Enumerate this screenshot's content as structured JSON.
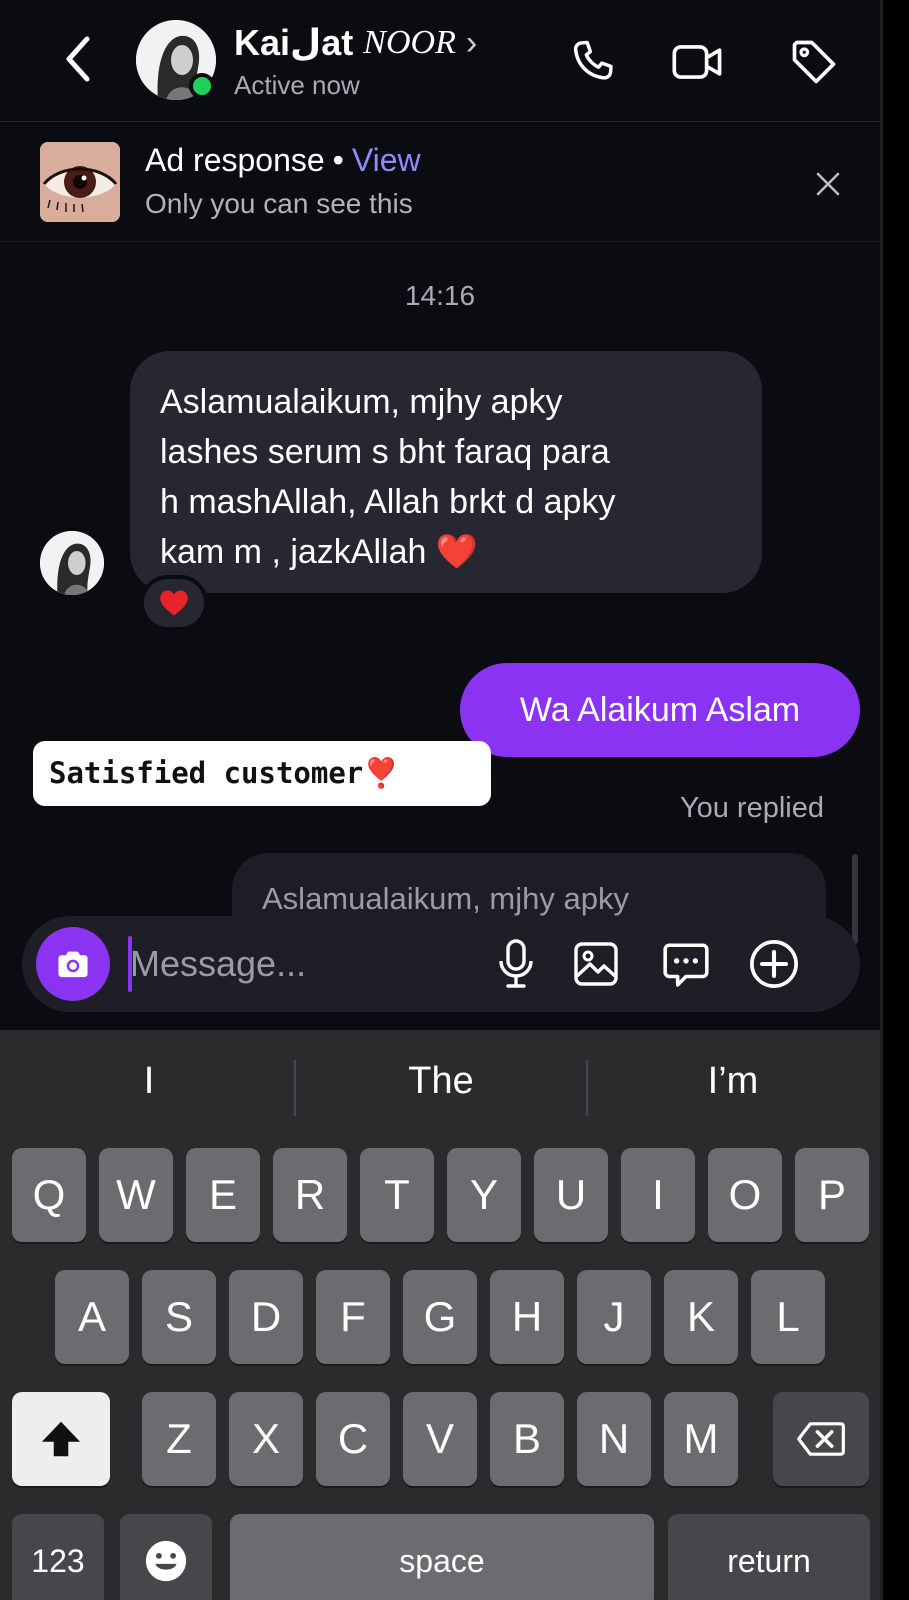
{
  "header": {
    "name_main": "Kaiلat",
    "name_sub": "NOOR",
    "status": "Active now",
    "chevron": "›",
    "icons": {
      "back": "chevron-left-icon",
      "call": "phone-icon",
      "video": "video-camera-icon",
      "tag": "tag-icon"
    },
    "online_color": "#1fd15a"
  },
  "ad_response": {
    "title": "Ad response",
    "separator": "•",
    "link": "View",
    "subtitle": "Only you can see this",
    "close_icon": "close-icon"
  },
  "thread": {
    "timestamp": "14:16",
    "incoming": {
      "lines": [
        "Aslamualaikum, mjhy  apky",
        "lashes serum s bht faraq para",
        "h mashAllah, Allah brkt d apky",
        "kam m , jazkAllah ❤️"
      ],
      "reaction": "❤️"
    },
    "outgoing": {
      "text": "Wa Alaikum Aslam"
    },
    "overlay_label": "Satisfied customer❣️",
    "replied_label": "You replied",
    "quoted_preview": "Aslamualaikum, mjhy  apky"
  },
  "composer": {
    "placeholder": "Message...",
    "icons": [
      "camera-icon",
      "microphone-icon",
      "gallery-icon",
      "sticker-chat-icon",
      "add-circle-icon"
    ],
    "accent": "#8a33f2"
  },
  "keyboard": {
    "suggestions": [
      "I",
      "The",
      "I’m"
    ],
    "row1": [
      "Q",
      "W",
      "E",
      "R",
      "T",
      "Y",
      "U",
      "I",
      "O",
      "P"
    ],
    "row2": [
      "A",
      "S",
      "D",
      "F",
      "G",
      "H",
      "J",
      "K",
      "L"
    ],
    "row3": [
      "Z",
      "X",
      "C",
      "V",
      "B",
      "N",
      "M"
    ],
    "numbers_label": "123",
    "space_label": "space",
    "return_label": "return",
    "icons": {
      "shift": "shift-icon",
      "delete": "backspace-icon",
      "emoji": "emoji-icon"
    }
  }
}
